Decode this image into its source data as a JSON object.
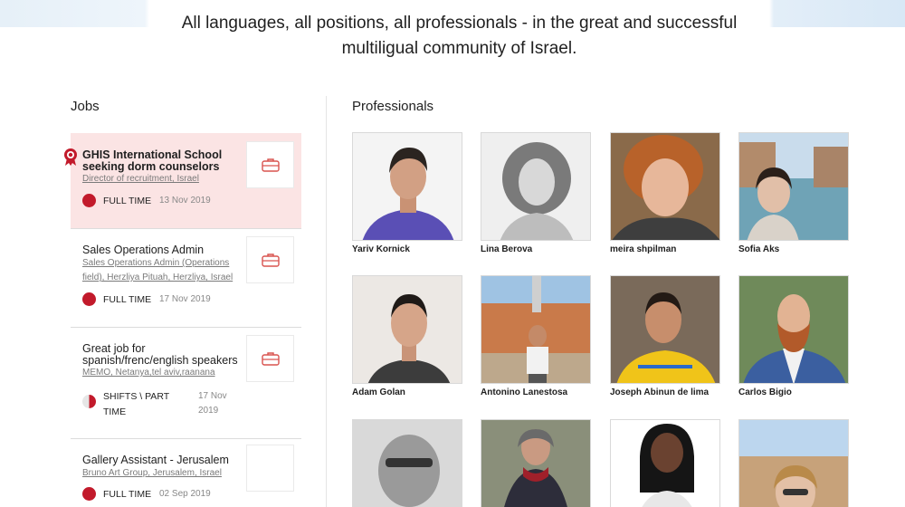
{
  "header": {
    "tagline": "All languages, all positions, all professionals - in the great and successful multiligual community of Israel."
  },
  "jobs": {
    "title": "Jobs",
    "items": [
      {
        "title": "GHIS International School seeking dorm counselors",
        "subtitle": "Director of recruitment, Israel",
        "type": "FULL TIME",
        "date": "13 Nov 2019",
        "featured": true,
        "type_fraction": 1.0
      },
      {
        "title": "Sales Operations Admin",
        "subtitle": "Sales Operations Admin (Operations field), Herzliya Pituah, Herzliya, Israel",
        "type": "FULL TIME",
        "date": "17 Nov 2019",
        "featured": false,
        "type_fraction": 1.0
      },
      {
        "title": "Great job for spanish/frenc/english speakers",
        "subtitle": "MEMO, Netanya,tel aviv,raanana",
        "type": "SHIFTS \\ PART TIME",
        "date": "17 Nov 2019",
        "featured": false,
        "type_fraction": 0.5
      },
      {
        "title": "Gallery Assistant - Jerusalem",
        "subtitle": "Bruno Art Group, Jerusalem, Israel",
        "type": "FULL TIME",
        "date": "02 Sep 2019",
        "featured": false,
        "type_fraction": 1.0
      }
    ]
  },
  "professionals": {
    "title": "Professionals",
    "items": [
      {
        "name": "Yariv Kornick"
      },
      {
        "name": "Lina Berova"
      },
      {
        "name": "meira shpilman"
      },
      {
        "name": "Sofia Aks"
      },
      {
        "name": "Adam Golan"
      },
      {
        "name": "Antonino Lanestosa"
      },
      {
        "name": "Joseph Abinun de lima"
      },
      {
        "name": "Carlos Bigio"
      },
      {
        "name": ""
      },
      {
        "name": ""
      },
      {
        "name": ""
      },
      {
        "name": ""
      }
    ]
  },
  "colors": {
    "accent": "#c21a2b",
    "featured_bg": "#fbe4e4"
  },
  "icons": {
    "job_logo": "briefcase-icon",
    "featured_badge": "award-ribbon-icon",
    "job_type": "pie-chart-icon"
  }
}
